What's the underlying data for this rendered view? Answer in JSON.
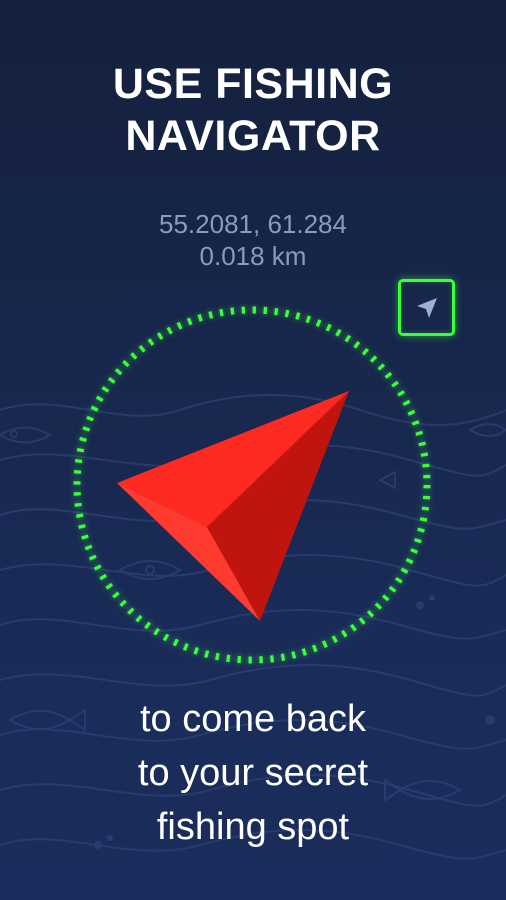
{
  "headline": {
    "line1": "USE FISHING",
    "line2": "NAVIGATOR"
  },
  "navigator": {
    "coordinates": "55.2081, 61.284",
    "distance": "0.018 km",
    "locate_icon": "navigation-arrow-icon",
    "pointer_icon": "direction-arrow-icon"
  },
  "tagline": {
    "line1": "to come back",
    "line2": "to your secret",
    "line3": "fishing spot"
  },
  "colors": {
    "background": "#17264a",
    "accent_green": "#3aff3a",
    "arrow_red": "#ff2a22",
    "arrow_dark_red": "#c0140f",
    "coord_text": "#8d9ab8"
  }
}
